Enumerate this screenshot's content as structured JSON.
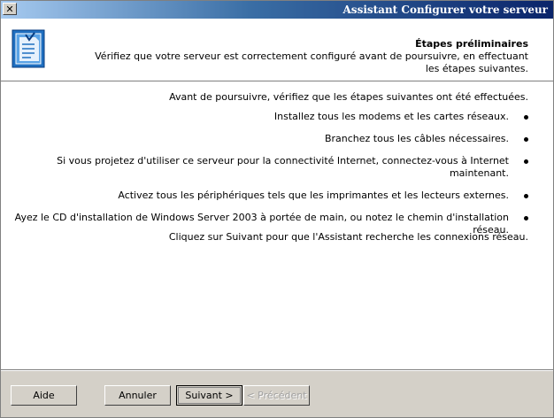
{
  "window": {
    "title": "Assistant Configurer votre serveur",
    "close_glyph": "✕"
  },
  "header": {
    "title": "Étapes préliminaires",
    "subtitle": "Vérifiez que votre serveur est correctement configuré avant de poursuivre, en effectuant les étapes suivantes.",
    "icon": "wizard-document-icon"
  },
  "content": {
    "intro": "Avant de poursuivre, vérifiez que les étapes suivantes ont été effectuées.",
    "steps": [
      "Installez tous les modems et les cartes réseaux.",
      "Branchez tous les câbles nécessaires.",
      "Si vous projetez d'utiliser ce serveur pour la connectivité Internet, connectez-vous à Internet maintenant.",
      "Activez tous les périphériques tels que les imprimantes et les lecteurs externes.",
      "Ayez le CD d'installation de Windows Server 2003 à portée de main, ou notez le chemin d'installation réseau."
    ],
    "closing": "Cliquez sur Suivant pour que l'Assistant recherche les connexions réseau."
  },
  "buttons": {
    "back": "< Précédent",
    "next": "Suivant >",
    "cancel": "Annuler",
    "help": "Aide"
  }
}
